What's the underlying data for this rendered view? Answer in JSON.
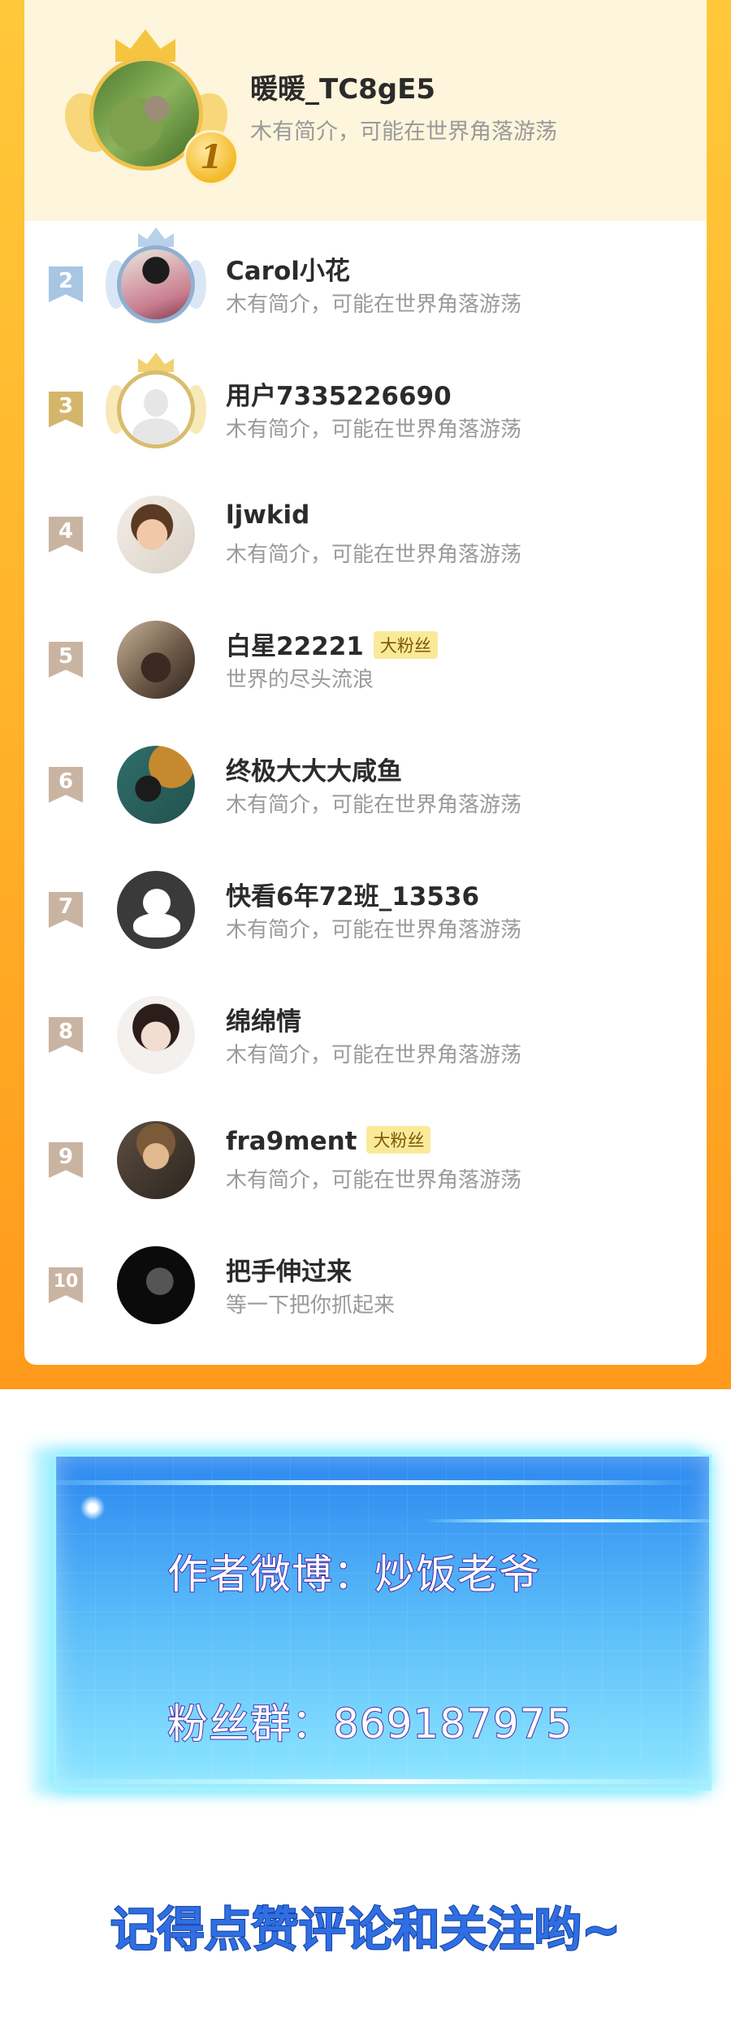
{
  "top_fan": {
    "rank": "1",
    "name": "暖暖_TC8gE5",
    "bio": "木有简介，可能在世界角落游荡"
  },
  "fans": [
    {
      "rank": "2",
      "name": "Carol小花",
      "bio": "木有简介，可能在世界角落游荡",
      "tag": ""
    },
    {
      "rank": "3",
      "name": "用户7335226690",
      "bio": "木有简介，可能在世界角落游荡",
      "tag": ""
    },
    {
      "rank": "4",
      "name": "ljwkid",
      "bio": "木有简介，可能在世界角落游荡",
      "tag": ""
    },
    {
      "rank": "5",
      "name": "白星22221",
      "bio": "世界的尽头流浪",
      "tag": "大粉丝"
    },
    {
      "rank": "6",
      "name": "终极大大大咸鱼",
      "bio": "木有简介，可能在世界角落游荡",
      "tag": ""
    },
    {
      "rank": "7",
      "name": "快看6年72班_13536",
      "bio": "木有简介，可能在世界角落游荡",
      "tag": ""
    },
    {
      "rank": "8",
      "name": "绵绵情",
      "bio": "木有简介，可能在世界角落游荡",
      "tag": ""
    },
    {
      "rank": "9",
      "name": "fra9ment",
      "bio": "木有简介，可能在世界角落游荡",
      "tag": "大粉丝"
    },
    {
      "rank": "10",
      "name": "把手伸过来",
      "bio": "等一下把你抓起来",
      "tag": ""
    }
  ],
  "promo": {
    "weibo": "作者微博：炒饭老爷",
    "group": "粉丝群：869187975",
    "cta": "记得点赞评论和关注哟~"
  },
  "colors": {
    "frame": "#ffb52c",
    "top_bg": "#fdf5dc",
    "fan_tag_bg": "#fbe99a",
    "panel": "#56b8f8",
    "cta_text": "#2f6ee3"
  }
}
